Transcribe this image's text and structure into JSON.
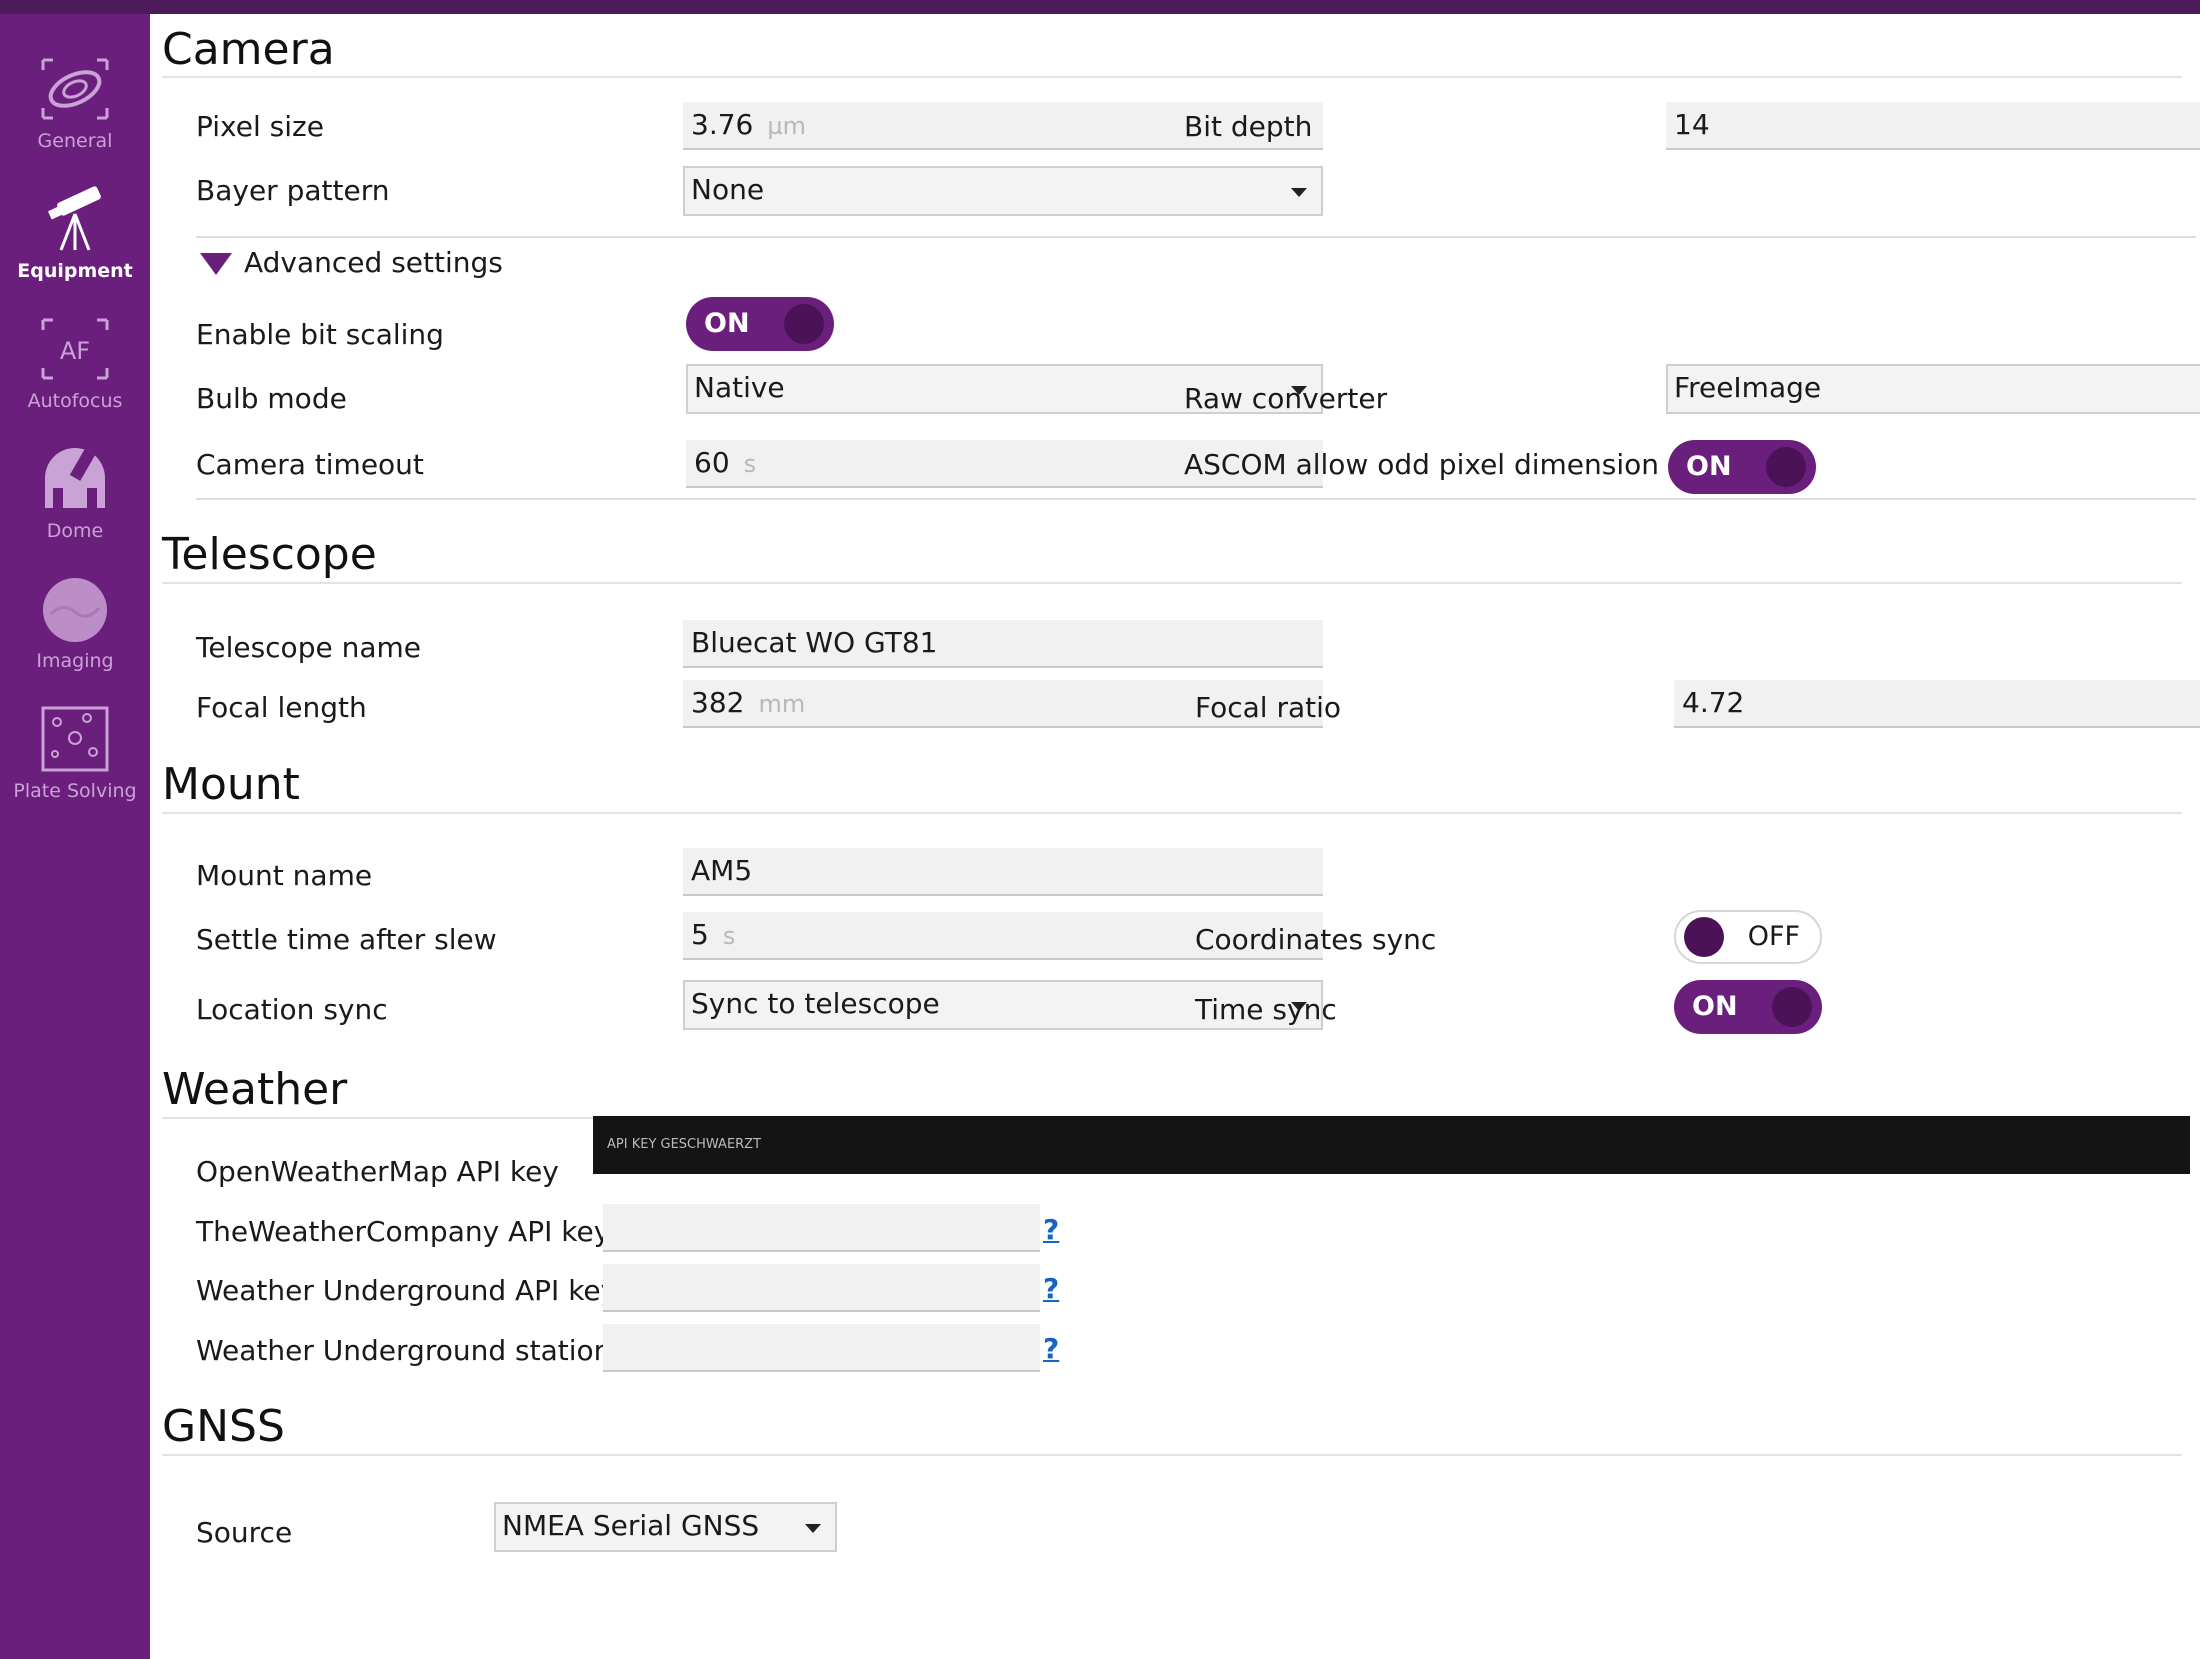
{
  "sidebar": {
    "items": [
      {
        "label": "General"
      },
      {
        "label": "Equipment"
      },
      {
        "label": "Autofocus",
        "icon_text": "AF"
      },
      {
        "label": "Dome"
      },
      {
        "label": "Imaging"
      },
      {
        "label": "Plate Solving"
      }
    ]
  },
  "camera": {
    "title": "Camera",
    "pixel_size": {
      "label": "Pixel size",
      "value": "3.76",
      "unit": "µm"
    },
    "bit_depth": {
      "label": "Bit depth",
      "value": "14"
    },
    "bayer_pattern": {
      "label": "Bayer pattern",
      "value": "None"
    },
    "advanced_label": "Advanced settings",
    "bit_scaling": {
      "label": "Enable bit scaling",
      "state": "ON"
    },
    "bulb_mode": {
      "label": "Bulb mode",
      "value": "Native"
    },
    "raw_converter": {
      "label": "Raw converter",
      "value": "FreeImage"
    },
    "timeout": {
      "label": "Camera timeout",
      "value": "60",
      "unit": "s"
    },
    "ascom_odd": {
      "label": "ASCOM allow odd pixel dimension",
      "state": "ON"
    }
  },
  "telescope": {
    "title": "Telescope",
    "name": {
      "label": "Telescope name",
      "value": "Bluecat WO GT81"
    },
    "focal_length": {
      "label": "Focal length",
      "value": "382",
      "unit": "mm"
    },
    "focal_ratio": {
      "label": "Focal ratio",
      "value": "4.72"
    }
  },
  "mount": {
    "title": "Mount",
    "name": {
      "label": "Mount name",
      "value": "AM5"
    },
    "settle_time": {
      "label": "Settle time after slew",
      "value": "5",
      "unit": "s"
    },
    "coord_sync": {
      "label": "Coordinates sync",
      "state": "OFF"
    },
    "location_sync": {
      "label": "Location sync",
      "value": "Sync to telescope"
    },
    "time_sync": {
      "label": "Time sync",
      "state": "ON"
    }
  },
  "weather": {
    "title": "Weather",
    "owm": {
      "label": "OpenWeatherMap API key",
      "redacted_text": "API KEY GESCHWAERZT"
    },
    "twc": {
      "label": "TheWeatherCompany API key",
      "value": "",
      "help": "?"
    },
    "wu_key": {
      "label": "Weather Underground API key",
      "value": "",
      "help": "?"
    },
    "wu_station": {
      "label": "Weather Underground station ID",
      "value": "",
      "help": "?"
    }
  },
  "gnss": {
    "title": "GNSS",
    "source": {
      "label": "Source",
      "value": "NMEA Serial GNSS"
    }
  },
  "colors": {
    "accent": "#6b1f7c",
    "sidebar": "#6b1f7c",
    "topbar": "#4d1a5c"
  }
}
